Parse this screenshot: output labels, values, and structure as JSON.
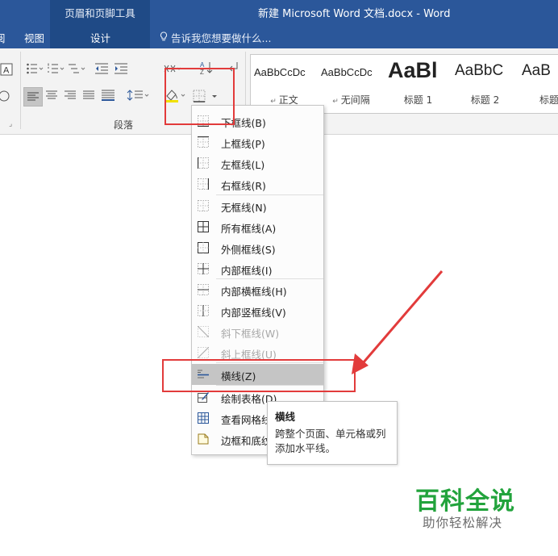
{
  "titlebar": {
    "context_tab_group": "页眉和页脚工具",
    "doc_title": "新建 Microsoft Word 文档.docx - Word",
    "tabs": [
      "阅",
      "视图",
      "设计"
    ],
    "tell_me": "告诉我您想要做什么..."
  },
  "ribbon": {
    "group_label": "段落",
    "styles": [
      {
        "sample": "AaBbCcDc",
        "name": "正文"
      },
      {
        "sample": "AaBbCcDc",
        "name": "无间隔"
      },
      {
        "sample": "AaBl",
        "name": "标题 1"
      },
      {
        "sample": "AaBbC",
        "name": "标题 2"
      },
      {
        "sample": "AaB",
        "name": "标题"
      }
    ]
  },
  "border_menu": {
    "items": [
      {
        "label": "下框线(B)",
        "icon": "border-bottom-icon",
        "disabled": false
      },
      {
        "label": "上框线(P)",
        "icon": "border-top-icon",
        "disabled": false
      },
      {
        "label": "左框线(L)",
        "icon": "border-left-icon",
        "disabled": false
      },
      {
        "label": "右框线(R)",
        "icon": "border-right-icon",
        "disabled": false
      },
      {
        "label": "无框线(N)",
        "icon": "border-none-icon",
        "disabled": false
      },
      {
        "label": "所有框线(A)",
        "icon": "border-all-icon",
        "disabled": false
      },
      {
        "label": "外侧框线(S)",
        "icon": "border-outside-icon",
        "disabled": false
      },
      {
        "label": "内部框线(I)",
        "icon": "border-inside-icon",
        "disabled": false
      },
      {
        "label": "内部横框线(H)",
        "icon": "border-inside-horizontal-icon",
        "disabled": false
      },
      {
        "label": "内部竖框线(V)",
        "icon": "border-inside-vertical-icon",
        "disabled": false
      },
      {
        "label": "斜下框线(W)",
        "icon": "diagonal-down-border-icon",
        "disabled": true
      },
      {
        "label": "斜上框线(U)",
        "icon": "diagonal-up-border-icon",
        "disabled": true
      },
      {
        "label": "横线(Z)",
        "icon": "horizontal-line-icon",
        "disabled": false,
        "selected": true
      },
      {
        "label": "绘制表格(D)",
        "icon": "draw-table-icon",
        "disabled": false
      },
      {
        "label": "查看网格线(G)",
        "icon": "view-gridlines-icon",
        "disabled": false
      },
      {
        "label": "边框和底纹(O)...",
        "icon": "borders-shading-icon",
        "disabled": false
      }
    ]
  },
  "tooltip": {
    "title": "横线",
    "body": "跨整个页面、单元格或列添加水平线。"
  },
  "watermark": {
    "main": "百科全说",
    "sub": "助你轻松解决"
  },
  "colors": {
    "title_bar": "#2b579a",
    "context_tab": "#1f4a86",
    "annotation_red": "#e23b3b",
    "watermark_green": "#22a33c"
  }
}
